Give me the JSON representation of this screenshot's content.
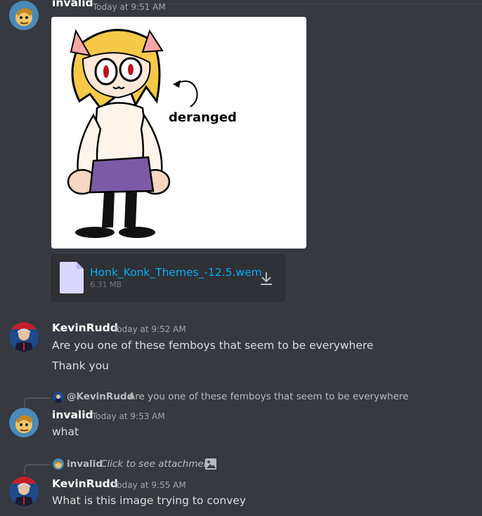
{
  "colors": {
    "background": "#36393f",
    "link": "#00b0f4",
    "author": "#ffffff",
    "text": "#dcddde",
    "muted": "#a3a6aa"
  },
  "messages": [
    {
      "author": "invalid",
      "timestamp": "Today at 9:51 AM",
      "avatar_icon": "rayman-avatar-icon",
      "image": {
        "caption": "deranged"
      },
      "file": {
        "name": "Honk_Konk_Themes_-12.5.wem",
        "size": "6.31 MB",
        "icon": "file-icon",
        "action_icon": "download-icon"
      }
    },
    {
      "author": "KevinRudd",
      "timestamp": "Today at 9:52 AM",
      "avatar_icon": "kevinrudd-avatar-icon",
      "lines": [
        "Are you one of these femboys that seem to be everywhere",
        "Thank you"
      ]
    },
    {
      "reply": {
        "author": "@KevinRudd",
        "text": "Are you one of these femboys that seem to be everywhere"
      },
      "author": "invalid",
      "timestamp": "Today at 9:53 AM",
      "lines": [
        "what"
      ]
    },
    {
      "reply": {
        "author": "invalid",
        "text": "Click to see attachment",
        "icon": "image-icon"
      },
      "author": "KevinRudd",
      "timestamp": "Today at 9:55 AM",
      "lines": [
        "What is this image trying to convey"
      ]
    }
  ]
}
